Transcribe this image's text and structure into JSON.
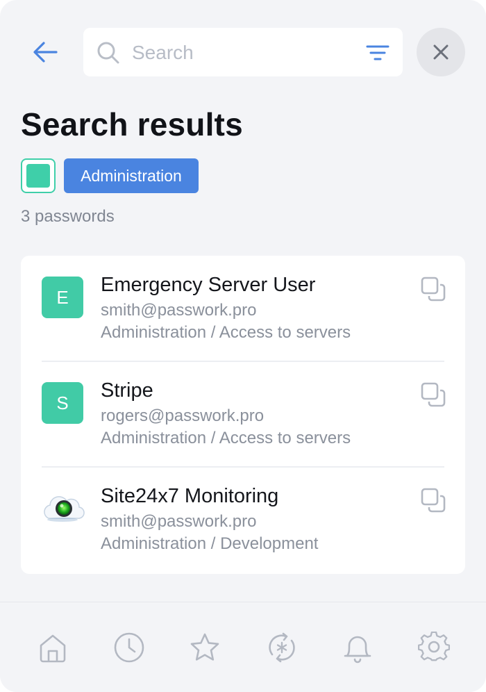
{
  "header": {
    "search_placeholder": "Search",
    "search_value": ""
  },
  "page": {
    "title": "Search results",
    "color_filter": "#3fcfa9",
    "tag_label": "Administration",
    "count_text": "3 passwords"
  },
  "results": [
    {
      "avatar_letter": "E",
      "avatar_color": "#41cba6",
      "title": "Emergency Server User",
      "login": "smith@passwork.pro",
      "path": "Administration / Access to servers"
    },
    {
      "avatar_letter": "S",
      "avatar_color": "#41cba6",
      "title": "Stripe",
      "login": "rogers@passwork.pro",
      "path": "Administration / Access to servers"
    },
    {
      "avatar_icon": "site24x7-cloud-icon",
      "title": "Site24x7 Monitoring",
      "login": "smith@passwork.pro",
      "path": "Administration / Development"
    }
  ],
  "nav": {
    "items": [
      "home-icon",
      "recent-clock-icon",
      "favorites-star-icon",
      "password-generator-icon",
      "notifications-bell-icon",
      "settings-gear-icon"
    ]
  },
  "colors": {
    "accent": "#4a84e0",
    "teal": "#3fcfa9",
    "icon_gray": "#b3b8c2",
    "background": "#f3f4f7"
  }
}
